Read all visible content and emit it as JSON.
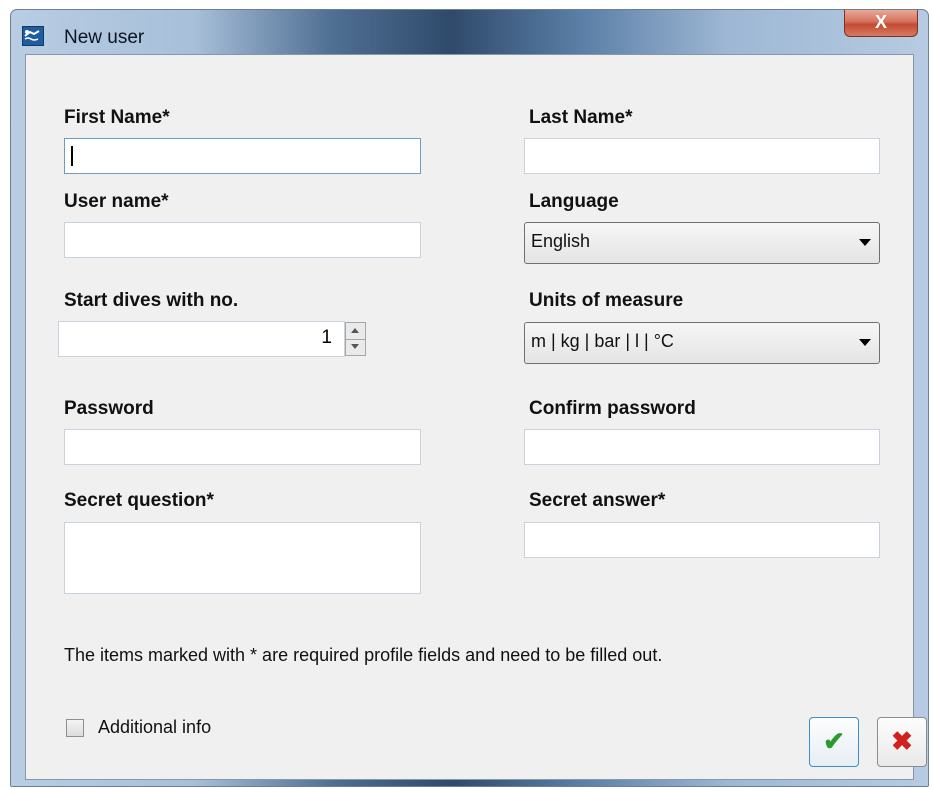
{
  "window": {
    "title": "New user",
    "close_glyph": "X",
    "icon": "diver-app-icon"
  },
  "form": {
    "first_name": {
      "label": "First Name*",
      "value": ""
    },
    "last_name": {
      "label": "Last Name*",
      "value": ""
    },
    "user_name": {
      "label": "User name*",
      "value": ""
    },
    "language": {
      "label": "Language",
      "value": "English"
    },
    "start_dives": {
      "label": "Start dives with no.",
      "value": "1"
    },
    "units": {
      "label": "Units of measure",
      "value": "m | kg | bar | l | °C"
    },
    "password": {
      "label": "Password",
      "value": ""
    },
    "confirm_password": {
      "label": "Confirm password",
      "value": ""
    },
    "secret_question": {
      "label": "Secret question*",
      "value": ""
    },
    "secret_answer": {
      "label": "Secret answer*",
      "value": ""
    }
  },
  "note": "The items marked with * are required profile fields and need to be filled out.",
  "additional_info": {
    "label": "Additional info",
    "checked": false
  },
  "buttons": {
    "ok_glyph": "✔",
    "cancel_glyph": "✖"
  },
  "colors": {
    "ok": "#2b9a2e",
    "cancel": "#d0211f",
    "client_bg": "#f0f0f0"
  }
}
